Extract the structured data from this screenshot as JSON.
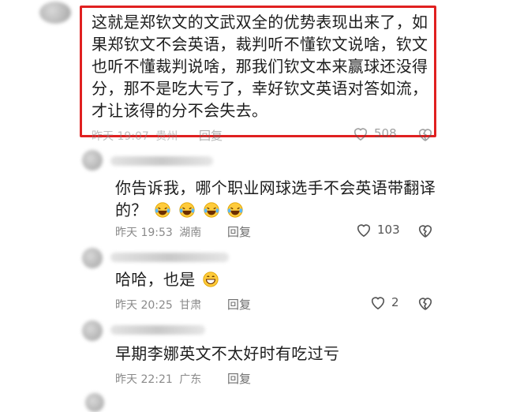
{
  "comments": [
    {
      "text": "这就是郑钦文的文武双全的优势表现出来了，如果郑钦文不会英语，裁判听不懂钦文说啥，钦文也听不懂裁判说啥，那我们钦文本来赢球还没得分，那不是吃大亏了，幸好钦文英语对答如流，才让该得的分不会失去。",
      "time": "昨天 19:07",
      "location": "贵州",
      "reply_label": "回复",
      "likes": "508",
      "highlighted": true
    },
    {
      "text": "你告诉我，哪个职业网球选手不会英语带翻译的？",
      "emoji": [
        "laughing-tears",
        "laughing-tears",
        "laughing-tears",
        "laughing-tears"
      ],
      "time": "昨天 19:53",
      "location": "湖南",
      "reply_label": "回复",
      "likes": "103"
    },
    {
      "text": "哈哈，也是",
      "emoji": [
        "grinning-face"
      ],
      "time": "昨天 20:25",
      "location": "甘肃",
      "reply_label": "回复",
      "likes": "2"
    },
    {
      "text": "早期李娜英文不太好时有吃过亏",
      "time": "昨天 22:21",
      "location": "广东",
      "reply_label": "回复"
    }
  ],
  "colors": {
    "highlight_border": "#e02020",
    "text": "#1d1d1d",
    "meta": "#8a8a8a"
  },
  "icons": [
    "heart-outline-icon",
    "broken-heart-icon",
    "laughing-tears-emoji",
    "grinning-emoji"
  ]
}
